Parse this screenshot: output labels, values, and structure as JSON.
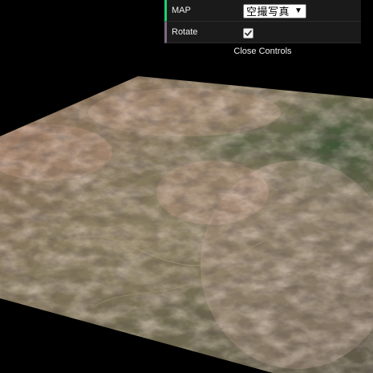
{
  "scene": {
    "background": "#000000",
    "rock_tone": "#b88c74",
    "plateau_tone": "#7d6e55",
    "forest_tone": "#3f5536"
  },
  "gui": {
    "map_label": "MAP",
    "map_value": "空撮写真",
    "map_dropdown_icon": "triangle-down",
    "rotate_label": "Rotate",
    "rotate_checked": true,
    "close_label": "Close Controls",
    "colors": {
      "option_accent": "#1ed36f",
      "boolean_accent": "#806787",
      "panel_bg": "#1a1a1a"
    }
  }
}
